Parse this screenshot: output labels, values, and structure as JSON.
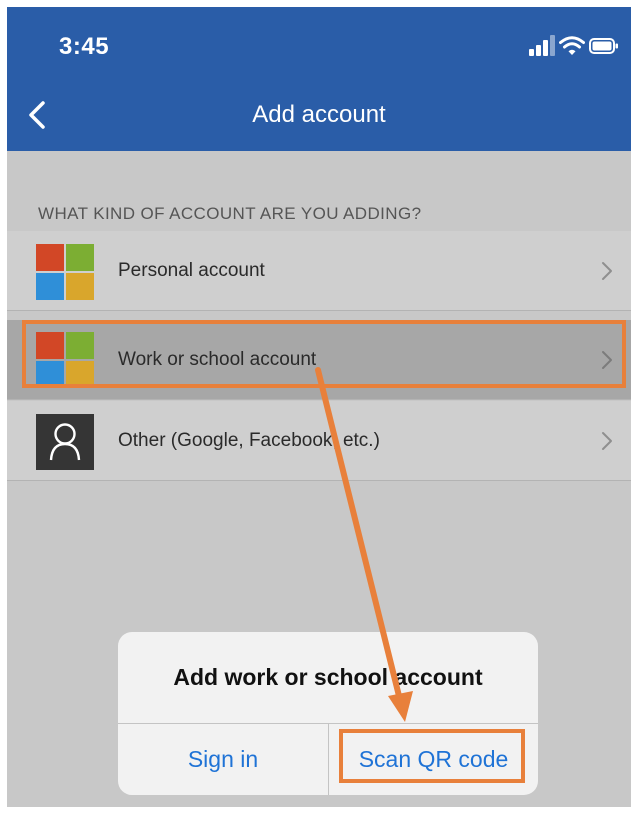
{
  "status_bar": {
    "time": "3:45",
    "icons": [
      "signal-icon",
      "wifi-icon",
      "battery-icon"
    ]
  },
  "nav": {
    "back_icon": "chevron-left-icon",
    "title": "Add account"
  },
  "section_header": "WHAT KIND OF ACCOUNT ARE YOU ADDING?",
  "accounts": [
    {
      "label": "Personal account",
      "icon": "microsoft-logo-icon",
      "selected": false
    },
    {
      "label": "Work or school account",
      "icon": "microsoft-logo-icon",
      "selected": true
    },
    {
      "label": "Other (Google, Facebook, etc.)",
      "icon": "user-icon",
      "selected": false
    }
  ],
  "action_sheet": {
    "title": "Add work or school account",
    "sign_in": "Sign in",
    "scan_qr": "Scan QR code"
  },
  "colors": {
    "header": "#2a5da8",
    "accent_blue": "#1f73d6",
    "annotation_orange": "#e8803b",
    "ms_red": "#d24726",
    "ms_green": "#7cae33",
    "ms_blue": "#2f8fd8",
    "ms_yellow": "#d9a62c"
  }
}
